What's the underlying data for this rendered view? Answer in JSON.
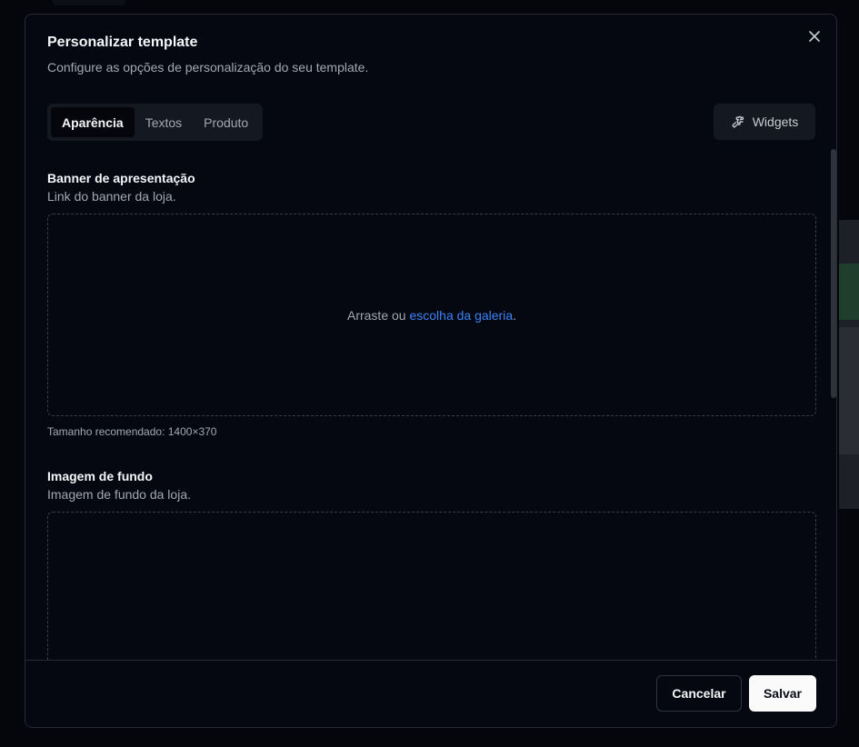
{
  "modal": {
    "title": "Personalizar template",
    "subtitle": "Configure as opções de personalização do seu template."
  },
  "tabs": [
    {
      "label": "Aparência",
      "active": true
    },
    {
      "label": "Textos",
      "active": false
    },
    {
      "label": "Produto",
      "active": false
    }
  ],
  "widgets": {
    "label": "Widgets",
    "icon": "puzzle-icon"
  },
  "banner": {
    "title": "Banner de apresentação",
    "desc": "Link do banner da loja.",
    "drop_prefix": "Arraste ou ",
    "drop_link": "escolha da galeria",
    "drop_suffix": ".",
    "hint": "Tamanho recomendado: 1400×370"
  },
  "background": {
    "title": "Imagem de fundo",
    "desc": "Imagem de fundo da loja."
  },
  "footer": {
    "cancel_label": "Cancelar",
    "save_label": "Salvar"
  },
  "colors": {
    "link": "#3b82f6",
    "surface": "#050811",
    "tab_bg": "#141821"
  }
}
